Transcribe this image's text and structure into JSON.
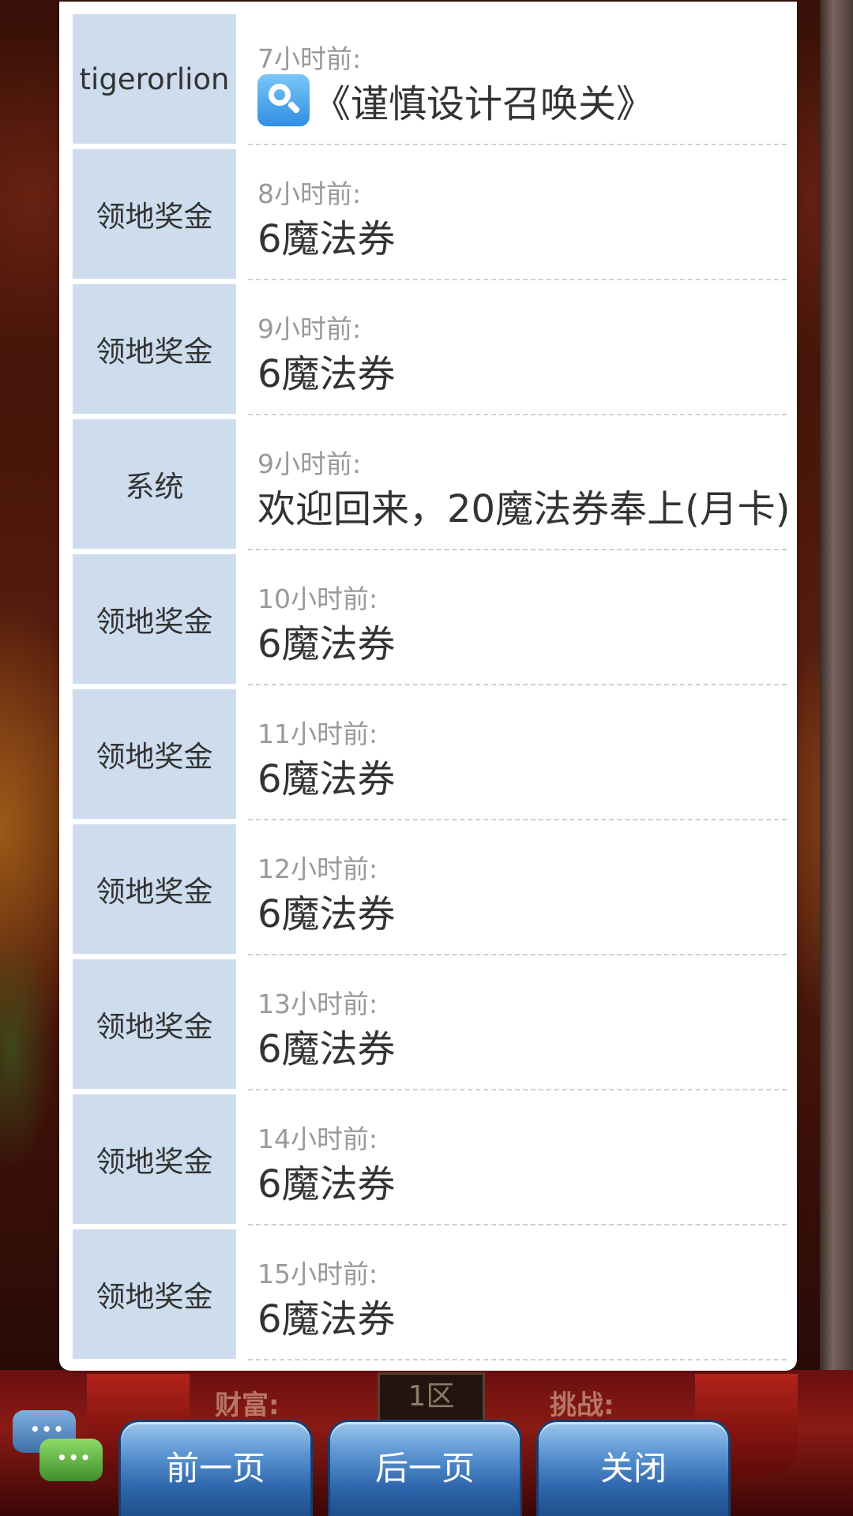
{
  "messages": [
    {
      "sender": "tigerorlion",
      "time": "7小时前:",
      "content": "《谨慎设计召唤关》",
      "icon": "search-icon"
    },
    {
      "sender": "领地奖金",
      "time": "8小时前:",
      "content": "6魔法券"
    },
    {
      "sender": "领地奖金",
      "time": "9小时前:",
      "content": "6魔法券"
    },
    {
      "sender": "系统",
      "time": "9小时前:",
      "content": "欢迎回来，20魔法券奉上(月卡)"
    },
    {
      "sender": "领地奖金",
      "time": "10小时前:",
      "content": "6魔法券"
    },
    {
      "sender": "领地奖金",
      "time": "11小时前:",
      "content": "6魔法券"
    },
    {
      "sender": "领地奖金",
      "time": "12小时前:",
      "content": "6魔法券"
    },
    {
      "sender": "领地奖金",
      "time": "13小时前:",
      "content": "6魔法券"
    },
    {
      "sender": "领地奖金",
      "time": "14小时前:",
      "content": "6魔法券"
    },
    {
      "sender": "领地奖金",
      "time": "15小时前:",
      "content": "6魔法券"
    }
  ],
  "buttons": {
    "prev": "前一页",
    "next": "后一页",
    "close": "关闭"
  },
  "hud": {
    "wealth": "财富:",
    "zone": "1区",
    "challenge": "挑战:"
  },
  "colors": {
    "sender_bg": "#cdddee",
    "button_blue": "#2d66ab"
  }
}
